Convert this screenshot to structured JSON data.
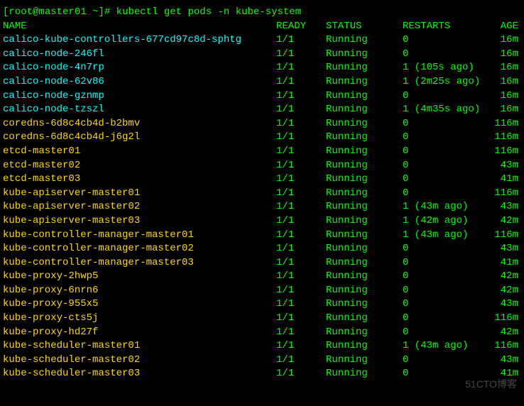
{
  "prompt": {
    "user": "root",
    "host": "master01",
    "path": "~",
    "command": "kubectl get pods -n kube-system"
  },
  "headers": {
    "name": "NAME",
    "ready": "READY",
    "status": "STATUS",
    "restarts": "RESTARTS",
    "age": "AGE"
  },
  "rows": [
    {
      "name": "calico-kube-controllers-677cd97c8d-sphtg",
      "ready": "1/1",
      "status": "Running",
      "restarts": "0",
      "age": "16m",
      "name_color": "cyan"
    },
    {
      "name": "calico-node-246fl",
      "ready": "1/1",
      "status": "Running",
      "restarts": "0",
      "age": "16m",
      "name_color": "cyan"
    },
    {
      "name": "calico-node-4n7rp",
      "ready": "1/1",
      "status": "Running",
      "restarts": "1 (105s ago)",
      "age": "16m",
      "name_color": "cyan"
    },
    {
      "name": "calico-node-62v86",
      "ready": "1/1",
      "status": "Running",
      "restarts": "1 (2m25s ago)",
      "age": "16m",
      "name_color": "cyan"
    },
    {
      "name": "calico-node-gznmp",
      "ready": "1/1",
      "status": "Running",
      "restarts": "0",
      "age": "16m",
      "name_color": "cyan"
    },
    {
      "name": "calico-node-tzszl",
      "ready": "1/1",
      "status": "Running",
      "restarts": "1 (4m35s ago)",
      "age": "16m",
      "name_color": "cyan"
    },
    {
      "name": "coredns-6d8c4cb4d-b2bmv",
      "ready": "1/1",
      "status": "Running",
      "restarts": "0",
      "age": "116m",
      "name_color": "yellow"
    },
    {
      "name": "coredns-6d8c4cb4d-j6g2l",
      "ready": "1/1",
      "status": "Running",
      "restarts": "0",
      "age": "116m",
      "name_color": "yellow"
    },
    {
      "name": "etcd-master01",
      "ready": "1/1",
      "status": "Running",
      "restarts": "0",
      "age": "116m",
      "name_color": "yellow"
    },
    {
      "name": "etcd-master02",
      "ready": "1/1",
      "status": "Running",
      "restarts": "0",
      "age": "43m",
      "name_color": "yellow"
    },
    {
      "name": "etcd-master03",
      "ready": "1/1",
      "status": "Running",
      "restarts": "0",
      "age": "41m",
      "name_color": "yellow"
    },
    {
      "name": "kube-apiserver-master01",
      "ready": "1/1",
      "status": "Running",
      "restarts": "0",
      "age": "116m",
      "name_color": "yellow"
    },
    {
      "name": "kube-apiserver-master02",
      "ready": "1/1",
      "status": "Running",
      "restarts": "1 (43m ago)",
      "age": "43m",
      "name_color": "yellow"
    },
    {
      "name": "kube-apiserver-master03",
      "ready": "1/1",
      "status": "Running",
      "restarts": "1 (42m ago)",
      "age": "42m",
      "name_color": "yellow"
    },
    {
      "name": "kube-controller-manager-master01",
      "ready": "1/1",
      "status": "Running",
      "restarts": "1 (43m ago)",
      "age": "116m",
      "name_color": "yellow"
    },
    {
      "name": "kube-controller-manager-master02",
      "ready": "1/1",
      "status": "Running",
      "restarts": "0",
      "age": "43m",
      "name_color": "yellow"
    },
    {
      "name": "kube-controller-manager-master03",
      "ready": "1/1",
      "status": "Running",
      "restarts": "0",
      "age": "41m",
      "name_color": "yellow"
    },
    {
      "name": "kube-proxy-2hwp5",
      "ready": "1/1",
      "status": "Running",
      "restarts": "0",
      "age": "42m",
      "name_color": "yellow"
    },
    {
      "name": "kube-proxy-6nrn6",
      "ready": "1/1",
      "status": "Running",
      "restarts": "0",
      "age": "42m",
      "name_color": "yellow"
    },
    {
      "name": "kube-proxy-955x5",
      "ready": "1/1",
      "status": "Running",
      "restarts": "0",
      "age": "43m",
      "name_color": "yellow"
    },
    {
      "name": "kube-proxy-cts5j",
      "ready": "1/1",
      "status": "Running",
      "restarts": "0",
      "age": "116m",
      "name_color": "yellow"
    },
    {
      "name": "kube-proxy-hd27f",
      "ready": "1/1",
      "status": "Running",
      "restarts": "0",
      "age": "42m",
      "name_color": "yellow"
    },
    {
      "name": "kube-scheduler-master01",
      "ready": "1/1",
      "status": "Running",
      "restarts": "1 (43m ago)",
      "age": "116m",
      "name_color": "yellow"
    },
    {
      "name": "kube-scheduler-master02",
      "ready": "1/1",
      "status": "Running",
      "restarts": "0",
      "age": "43m",
      "name_color": "yellow"
    },
    {
      "name": "kube-scheduler-master03",
      "ready": "1/1",
      "status": "Running",
      "restarts": "0",
      "age": "41m",
      "name_color": "yellow"
    }
  ],
  "watermark": "51CTO博客"
}
